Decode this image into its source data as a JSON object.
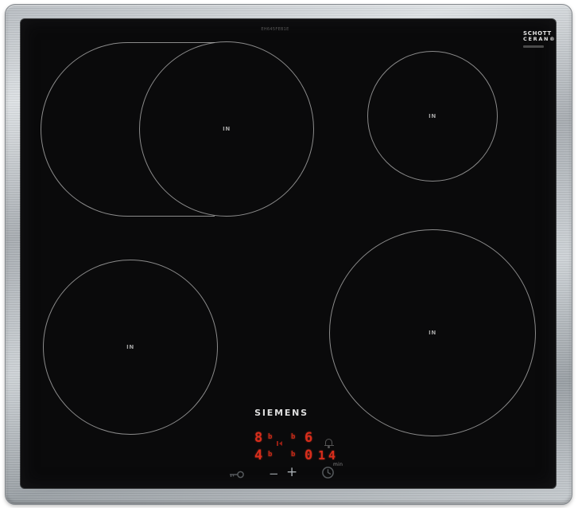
{
  "device": {
    "brand": "SIEMENS",
    "model_label": "EH645FEB1E",
    "glass_brand": {
      "line1": "SCHOTT",
      "line2": "CERAN®"
    }
  },
  "zones": {
    "top_left": {
      "label": "IN"
    },
    "top_right": {
      "label": "IN"
    },
    "bottom_left": {
      "label": "IN"
    },
    "bottom_right": {
      "label": "IN"
    }
  },
  "display": {
    "row1": {
      "left_digit": "8",
      "left_suffix": "b",
      "right_prefix": "b",
      "right_digit": "6"
    },
    "row2": {
      "left_digit": "4",
      "left_suffix": "b",
      "right_prefix": "b",
      "right_digit": "0"
    },
    "timer": {
      "value": "14",
      "unit": "min"
    }
  },
  "controls": {
    "minus_label": "−",
    "plus_label": "+"
  },
  "icons": {
    "bell": "bell-icon",
    "clock_timer": "clock-icon",
    "child_lock": "key-icon",
    "zone_link": "zone-link-icon"
  },
  "colors": {
    "led_red": "#d92d1b",
    "glass_black": "#0a0a0b",
    "frame_silver": "#c3c8cc",
    "zone_outline": "#aaaaaa"
  }
}
